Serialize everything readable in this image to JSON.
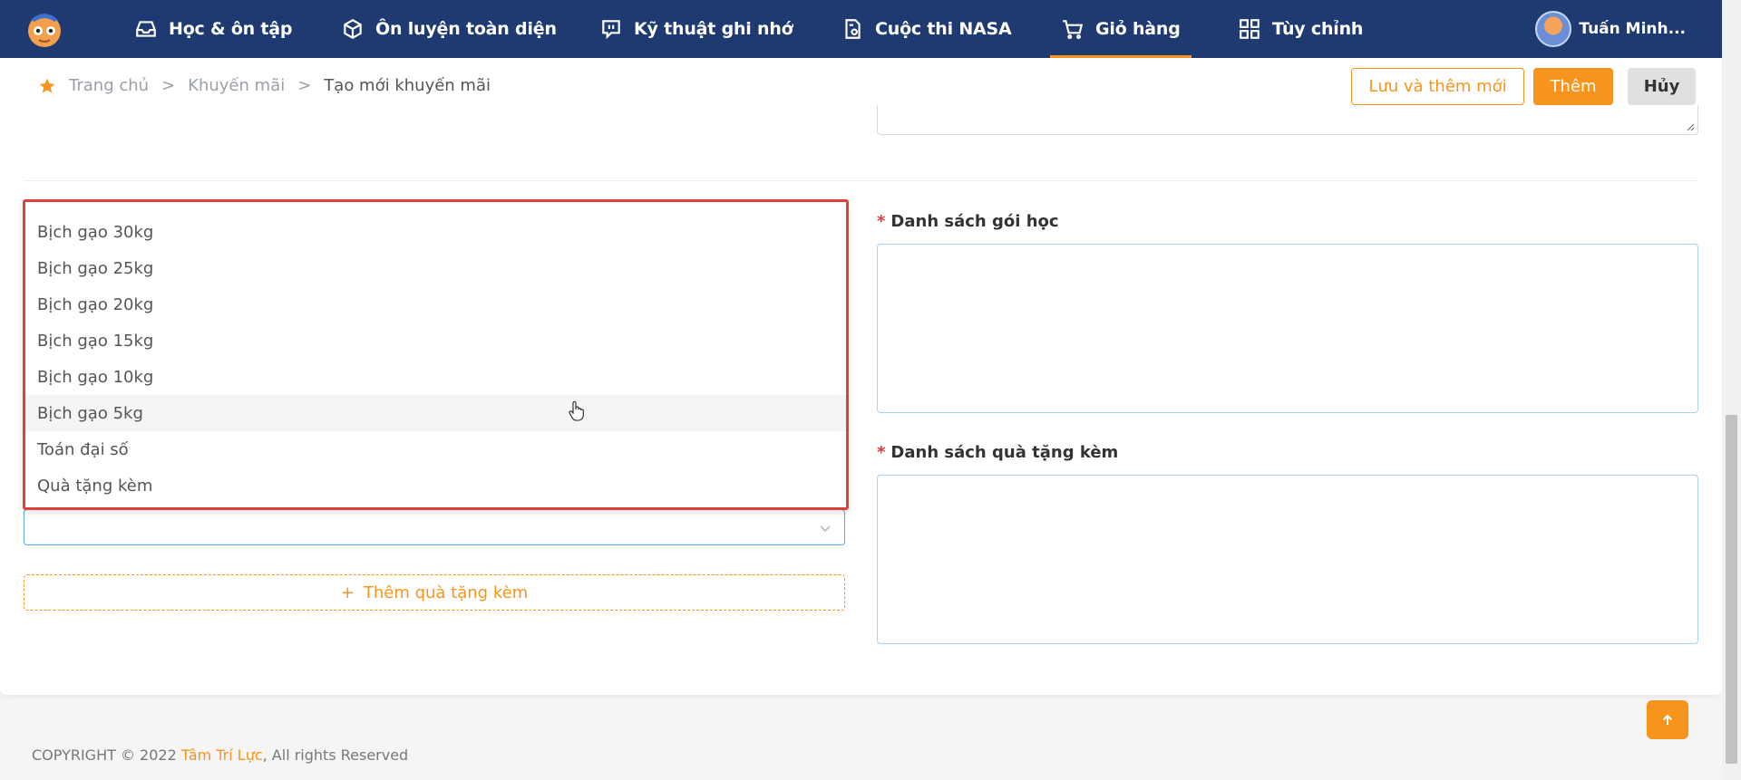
{
  "nav": {
    "items": [
      {
        "label": "Học & ôn tập",
        "icon": "inbox-icon"
      },
      {
        "label": "Ôn luyện toàn diện",
        "icon": "box-icon"
      },
      {
        "label": "Kỹ thuật ghi nhớ",
        "icon": "chat-icon"
      },
      {
        "label": "Cuộc thi NASA",
        "icon": "document-settings-icon"
      },
      {
        "label": "Giỏ hàng",
        "icon": "cart-icon",
        "active": true
      },
      {
        "label": "Tùy chỉnh",
        "icon": "grid-icon"
      }
    ],
    "user_name": "Tuấn Minh..."
  },
  "breadcrumb": [
    "Trang chủ",
    ">",
    "Khuyến mãi",
    ">",
    "Tạo mới khuyến mãi"
  ],
  "actions": {
    "save_add": "Lưu và thêm mới",
    "add": "Thêm",
    "cancel": "Hủy"
  },
  "fields": {
    "course_list_label": "Danh sách gói học",
    "gift_list_label": "Danh sách quà tặng kèm",
    "required_mark": "*"
  },
  "dropdown": {
    "options": [
      "Bịch gạo 30kg",
      "Bịch gạo 25kg",
      "Bịch gạo 20kg",
      "Bịch gạo 15kg",
      "Bịch gạo 10kg",
      "Bịch gạo 5kg",
      "Toán đại số",
      "Quà tặng kèm"
    ],
    "hovered_index": 5
  },
  "add_gift": {
    "plus": "+",
    "label": "Thêm quà tặng kèm"
  },
  "footer": {
    "prefix": "COPYRIGHT © 2022 ",
    "brand": "Tâm Trí Lực",
    "suffix": ", All rights Reserved"
  },
  "colors": {
    "nav_bg": "#1f3a70",
    "accent": "#f7941d",
    "highlight_border": "#e0403a"
  }
}
